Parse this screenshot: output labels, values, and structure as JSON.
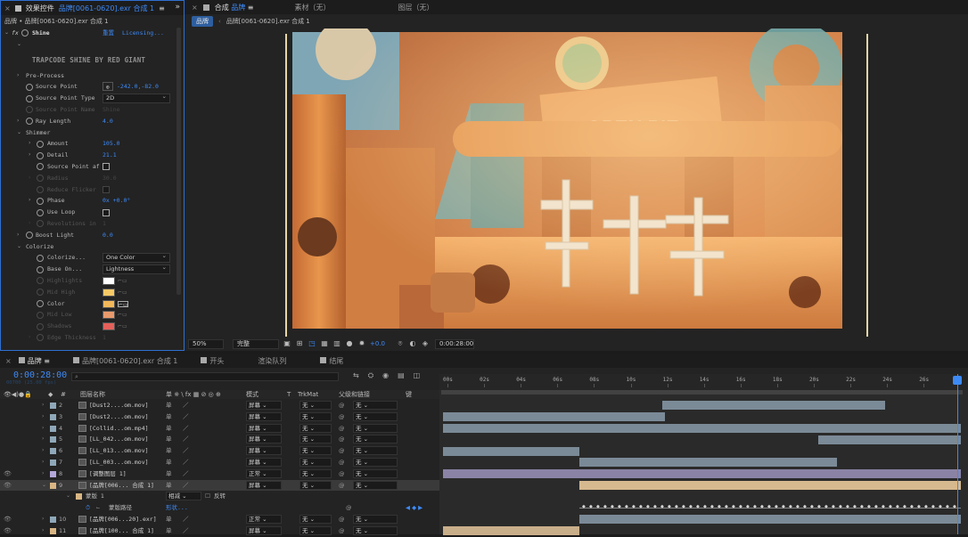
{
  "effect_controls": {
    "panel_title": "效果控件",
    "comp_ref": "品牌[0061-0620].exr 合成 1",
    "menu_icon": "hamburger-icon",
    "breadcrumb": "品牌 • 品牌[0061-0620].exr 合成 1",
    "effect_name": "Shine",
    "reset_label": "重置",
    "licensing_label": "Licensing...",
    "brand_title": "TRAPCODE SHINE BY RED GIANT",
    "props": {
      "pre_process": "Pre-Process",
      "source_point": {
        "label": "Source Point",
        "value": "-242.0,-82.0"
      },
      "source_point_type": {
        "label": "Source Point Type",
        "value": "2D"
      },
      "source_point_name": {
        "label": "Source Point Name",
        "value": "Shine"
      },
      "ray_length": {
        "label": "Ray Length",
        "value": "4.0"
      },
      "shimmer": "Shimmer",
      "amount": {
        "label": "Amount",
        "value": "105.0"
      },
      "detail": {
        "label": "Detail",
        "value": "21.1"
      },
      "source_point_af": {
        "label": "Source Point af"
      },
      "radius": {
        "label": "Radius",
        "value": "30.0"
      },
      "reduce_flicker": {
        "label": "Reduce Flicker"
      },
      "phase": {
        "label": "Phase",
        "value": "0x +0.0°"
      },
      "use_loop": {
        "label": "Use Loop"
      },
      "revolutions": {
        "label": "Revolutions in",
        "value": "1"
      },
      "boost_light": {
        "label": "Boost Light",
        "value": "0.0"
      },
      "colorize_group": "Colorize",
      "colorize": {
        "label": "Colorize...",
        "value": "One Color"
      },
      "base_on": {
        "label": "Base On...",
        "value": "Lightness"
      },
      "highlights": {
        "label": "Highlights"
      },
      "mid_high": {
        "label": "Mid High"
      },
      "color": {
        "label": "Color"
      },
      "mid_low": {
        "label": "Mid Low"
      },
      "shadows": {
        "label": "Shadows"
      },
      "edge_thickness": {
        "label": "Edge Thickness",
        "value": "1"
      }
    },
    "swatch_colors": {
      "highlights": "#ffffff",
      "mid_high": "#f6c966",
      "color": "#f3b85a",
      "mid_low": "#e99a6c",
      "shadows": "#e6605b"
    }
  },
  "viewer": {
    "tab_comp": "合成",
    "tab_comp_name": "品牌",
    "tab_footage": "素材（无）",
    "tab_layer": "图层（无）",
    "crumb_active": "品牌",
    "crumb_second": "品牌[0061-0620].exr 合成 1",
    "zoom": "50%",
    "quality": "完整",
    "exposure": "+0.0",
    "timecode": "0:00:28:00"
  },
  "timeline": {
    "tabs": [
      "品牌",
      "品牌[0061-0620].exr 合成 1",
      "开头",
      "渲染队列",
      "结尾"
    ],
    "current_time": "0:00:28:00",
    "fps_line": "00700 (25.00 fps)",
    "search_icon": "magnifier-icon",
    "columns": {
      "name": "图层名称",
      "switches": "单 ※ \\ fx ▦ ⊘ ◎ ⊕",
      "mode": "模式",
      "t": "T",
      "trkmat": "TrkMat",
      "parent": "父级和链接",
      "key": "键"
    },
    "ruler_ticks": [
      "00s",
      "02s",
      "04s",
      "06s",
      "08s",
      "10s",
      "12s",
      "14s",
      "16s",
      "18s",
      "20s",
      "22s",
      "24s",
      "26s"
    ],
    "layers": [
      {
        "num": "2",
        "name": "[Dust2....om.mov]",
        "mode": "屏幕",
        "trk": "无",
        "parent": "无",
        "label": "#8fa8b9"
      },
      {
        "num": "3",
        "name": "[Dust2....om.mov]",
        "mode": "屏幕",
        "trk": "无",
        "parent": "无",
        "label": "#8fa8b9"
      },
      {
        "num": "4",
        "name": "[Collid...om.mp4]",
        "mode": "屏幕",
        "trk": "无",
        "parent": "无",
        "label": "#8fa8b9"
      },
      {
        "num": "5",
        "name": "[LL_042...om.mov]",
        "mode": "屏幕",
        "trk": "无",
        "parent": "无",
        "label": "#8fa8b9"
      },
      {
        "num": "6",
        "name": "[LL_013...om.mov]",
        "mode": "屏幕",
        "trk": "无",
        "parent": "无",
        "label": "#8fa8b9"
      },
      {
        "num": "7",
        "name": "[LL_003...om.mov]",
        "mode": "屏幕",
        "trk": "无",
        "parent": "无",
        "label": "#8fa8b9"
      },
      {
        "num": "8",
        "name": "[调整图层 1]",
        "mode": "正常",
        "trk": "无",
        "parent": "无",
        "label": "#b3a6d9"
      },
      {
        "num": "9",
        "name": "[品牌[006... 合成 1]",
        "mode": "屏幕",
        "trk": "无",
        "parent": "无",
        "label": "#d9b684",
        "selected": true
      },
      {
        "num": "10",
        "name": "[品牌[006...20].exr]",
        "mode": "正常",
        "trk": "无",
        "parent": "无",
        "label": "#8fa8b9"
      },
      {
        "num": "11",
        "name": "[品牌[100... 合成 1]",
        "mode": "屏幕",
        "trk": "无",
        "parent": "无",
        "label": "#d9b684"
      }
    ],
    "mask": {
      "label": "蒙版 1",
      "mode": "相减",
      "invert": "反转",
      "path_label": "蒙版路径",
      "shape": "形状..."
    },
    "bar_colors": {
      "blue": "#7b8a97",
      "purple": "#8a83a6",
      "tan": "#c9ae8a",
      "selected": "#d6b98f"
    }
  }
}
